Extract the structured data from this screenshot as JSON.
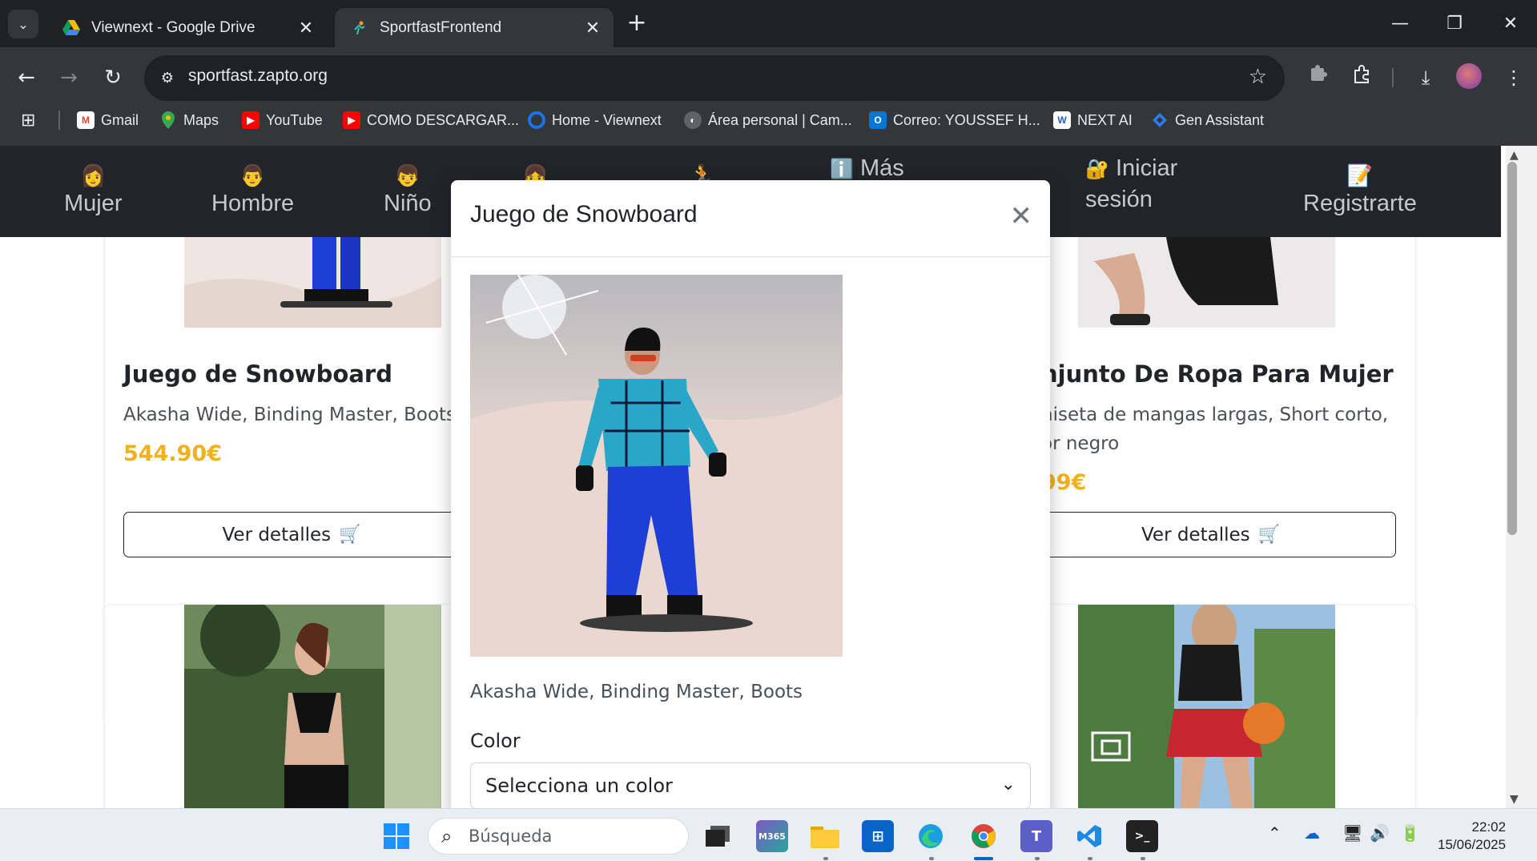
{
  "browser": {
    "tabs": [
      {
        "title": "Viewnext - Google Drive",
        "active": false
      },
      {
        "title": "SportfastFrontend",
        "active": true
      }
    ],
    "url": "sportfast.zapto.org",
    "bookmarks": [
      {
        "label": "Gmail",
        "icon": "gmail-icon",
        "color": "#ea4335"
      },
      {
        "label": "Maps",
        "icon": "maps-icon",
        "color": "#34a853"
      },
      {
        "label": "YouTube",
        "icon": "youtube-icon",
        "color": "#ff0000"
      },
      {
        "label": "COMO DESCARGAR...",
        "icon": "youtube-icon",
        "color": "#ff0000"
      },
      {
        "label": "Home - Viewnext",
        "icon": "viewnext-icon",
        "color": "#1a73e8"
      },
      {
        "label": "Área personal | Cam...",
        "icon": "globe-icon",
        "color": "#9aa0a6"
      },
      {
        "label": "Correo: YOUSSEF H...",
        "icon": "outlook-icon",
        "color": "#0078d4"
      },
      {
        "label": "NEXT AI",
        "icon": "next-ai-icon",
        "color": "#2a5bd7"
      },
      {
        "label": "Gen Assistant",
        "icon": "gen-assistant-icon",
        "color": "#2b7de9"
      }
    ]
  },
  "site": {
    "nav": {
      "mujer": "Mujer",
      "hombre": "Hombre",
      "nino": "Niño",
      "mas": "Más",
      "iniciar": "Iniciar",
      "sesion": "sesión",
      "registrarte": "Registrarte"
    },
    "products": [
      {
        "title": "Juego de Snowboard",
        "desc": "Akasha Wide, Binding Master, Boots",
        "price": "544.90€",
        "button": "Ver detalles"
      },
      {
        "title": "njunto De Ropa Para Mujer",
        "desc_line1": "niseta de mangas largas, Short corto,",
        "desc_line2": "or negro",
        "price": "99€",
        "button": "Ver detalles"
      }
    ],
    "modal": {
      "title": "Juego de Snowboard",
      "description": "Akasha Wide, Binding Master, Boots",
      "color_label": "Color",
      "color_select": "Selecciona un color"
    },
    "accent_price_color": "#f2b01e"
  },
  "taskbar": {
    "search_placeholder": "Búsqueda",
    "time": "22:02",
    "date": "15/06/2025"
  }
}
